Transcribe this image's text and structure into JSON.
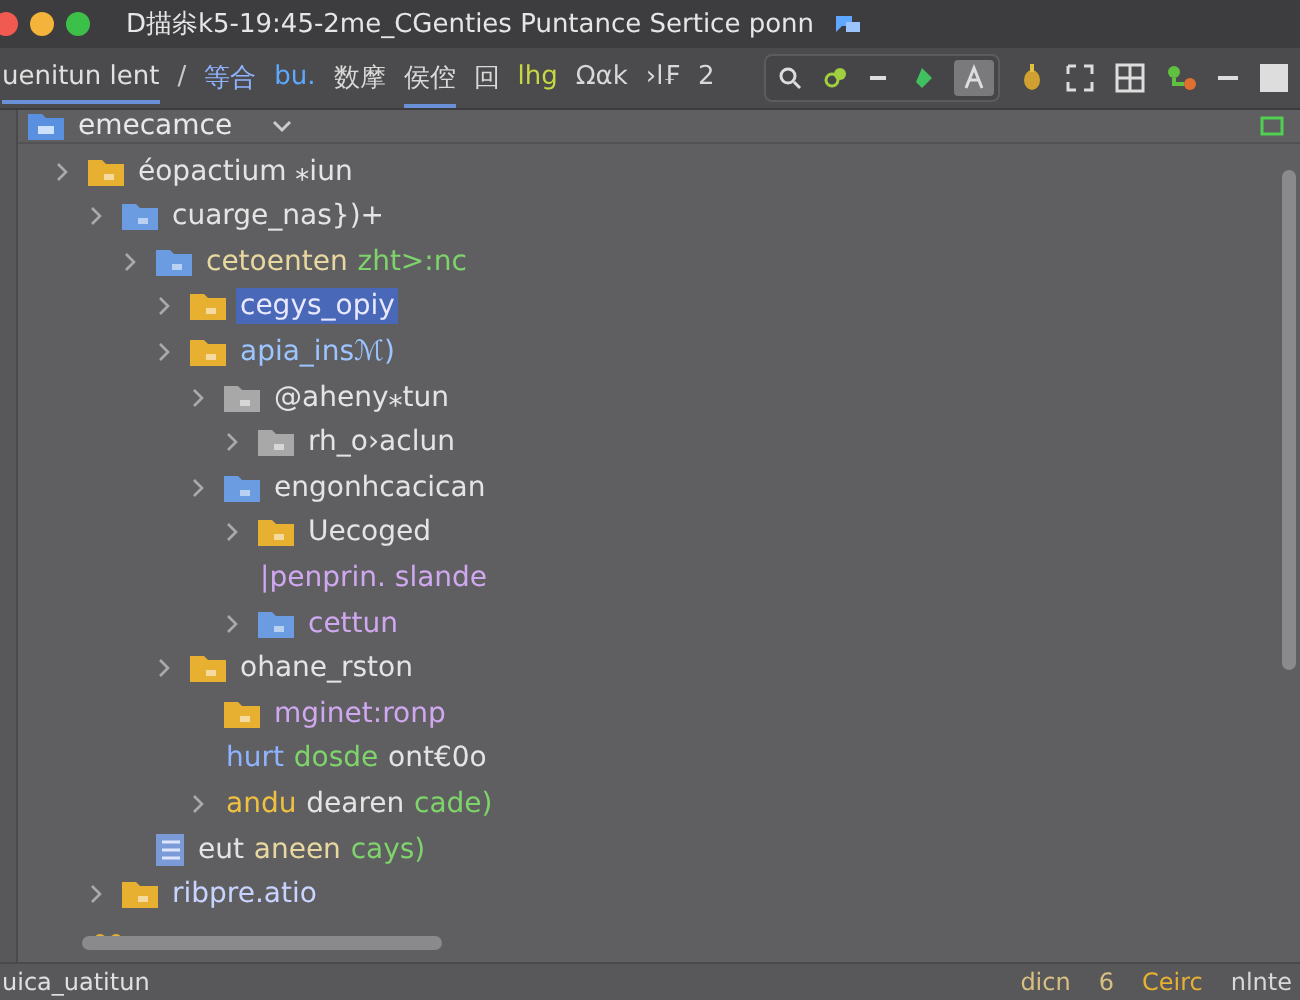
{
  "window": {
    "title": "D描尜k5-19:45-2me_CGenties  Puntance  Sertice  ponn"
  },
  "toolbar": {
    "tabs": [
      {
        "label": "uenitun lent",
        "selected": true,
        "color": "#e0e0e0"
      },
      {
        "label": "/",
        "selected": false,
        "color": "#c8c8c8"
      },
      {
        "label": "等合",
        "selected": false,
        "color": "#8fb4ff"
      },
      {
        "label": "bu.",
        "selected": false,
        "color": "#5fa8ff"
      },
      {
        "label": "数摩",
        "selected": false,
        "color": "#d8d8d8"
      },
      {
        "label": "侯倥",
        "selected": true,
        "color": "#d8d8d8"
      },
      {
        "label": "回",
        "selected": false,
        "color": "#d8d8d8"
      },
      {
        "label": "lhg",
        "selected": false,
        "color": "#c8d840"
      },
      {
        "label": "Ωαk",
        "selected": false,
        "color": "#d8d8d8"
      },
      {
        "label": "›l₣",
        "selected": false,
        "color": "#d8d8d8"
      },
      {
        "label": "2",
        "selected": false,
        "color": "#d8d8d8"
      }
    ]
  },
  "project": {
    "name": "emecamce"
  },
  "tree": [
    {
      "kind": "folder",
      "color": "#e8b030",
      "arrow": true,
      "selected": false,
      "parts": [
        {
          "text": "éopactium ⁎iun",
          "color": "#e4e4e4"
        }
      ],
      "children": [
        {
          "kind": "folder",
          "color": "#6b9be0",
          "arrow": true,
          "selected": false,
          "parts": [
            {
              "text": "cuarge_nas})+",
              "color": "#e4e4e4"
            }
          ],
          "children": [
            {
              "kind": "folder",
              "color": "#6b9be0",
              "arrow": true,
              "selected": false,
              "parts": [
                {
                  "text": "cetoenten",
                  "color": "#e8d8a0"
                },
                {
                  "text": "zht>:nc",
                  "color": "#7ed36a"
                }
              ],
              "children": [
                {
                  "kind": "folder",
                  "color": "#e8b030",
                  "arrow": true,
                  "selected": true,
                  "parts": [
                    {
                      "text": "cegys_opiy",
                      "color": "#e8e8ff"
                    }
                  ]
                },
                {
                  "kind": "folder",
                  "color": "#e8b030",
                  "arrow": true,
                  "selected": false,
                  "parts": [
                    {
                      "text": "apia_insℳ)",
                      "color": "#9cc4ff"
                    }
                  ],
                  "children": [
                    {
                      "kind": "folder",
                      "color": "#a8a8a8",
                      "arrow": true,
                      "selected": false,
                      "parts": [
                        {
                          "text": "@aheny⁎tun",
                          "color": "#e4e4e4"
                        }
                      ],
                      "children": [
                        {
                          "kind": "folder",
                          "color": "#a8a8a8",
                          "arrow": true,
                          "selected": false,
                          "parts": [
                            {
                              "text": "rh_o›aclun",
                              "color": "#e4e4e4"
                            }
                          ]
                        }
                      ]
                    },
                    {
                      "kind": "folder",
                      "color": "#6b9be0",
                      "arrow": true,
                      "selected": false,
                      "parts": [
                        {
                          "text": "engonhcacican",
                          "color": "#e4e4e4"
                        }
                      ],
                      "children": [
                        {
                          "kind": "folder",
                          "color": "#e8b030",
                          "arrow": true,
                          "selected": false,
                          "parts": [
                            {
                              "text": "Uecoged",
                              "color": "#e4e4e4"
                            }
                          ]
                        },
                        {
                          "kind": "text",
                          "arrow": false,
                          "selected": false,
                          "parts": [
                            {
                              "text": "|penprin. slande",
                              "color": "#d0a8f0"
                            }
                          ]
                        },
                        {
                          "kind": "folder",
                          "color": "#6b9be0",
                          "arrow": true,
                          "selected": false,
                          "parts": [
                            {
                              "text": "cettun",
                              "color": "#d0a8f0"
                            }
                          ]
                        }
                      ]
                    }
                  ]
                },
                {
                  "kind": "folder",
                  "color": "#e8b030",
                  "arrow": true,
                  "selected": false,
                  "parts": [
                    {
                      "text": "ohane_rston",
                      "color": "#e4e4e4"
                    }
                  ],
                  "children": [
                    {
                      "kind": "folder",
                      "color": "#e8b030",
                      "arrow": false,
                      "selected": false,
                      "parts": [
                        {
                          "text": "mginet:ronp",
                          "color": "#d0a8f0"
                        }
                      ]
                    },
                    {
                      "kind": "text",
                      "arrow": false,
                      "selected": false,
                      "parts": [
                        {
                          "text": "hurt",
                          "color": "#8fb4ff"
                        },
                        {
                          "text": "dosde",
                          "color": "#7ed36a"
                        },
                        {
                          "text": "ont€0o",
                          "color": "#e4e4e4"
                        }
                      ]
                    },
                    {
                      "kind": "text",
                      "arrow": true,
                      "selected": false,
                      "parts": [
                        {
                          "text": "andu",
                          "color": "#f0c040"
                        },
                        {
                          "text": "dearen",
                          "color": "#e4e4e4"
                        },
                        {
                          "text": "cade)",
                          "color": "#7ed36a"
                        }
                      ]
                    }
                  ]
                }
              ]
            },
            {
              "kind": "list",
              "arrow": false,
              "selected": false,
              "parts": [
                {
                  "text": "eut",
                  "color": "#e4e4e4"
                },
                {
                  "text": "aneen",
                  "color": "#e8d8a0"
                },
                {
                  "text": "cays)",
                  "color": "#7ed36a"
                }
              ]
            }
          ]
        },
        {
          "kind": "folder",
          "color": "#e8b030",
          "arrow": true,
          "selected": false,
          "parts": [
            {
              "text": "ribpre.atio",
              "color": "#c8d4ff"
            }
          ]
        }
      ]
    }
  ],
  "status_bar": {
    "left": "uica_uatitun",
    "right": [
      {
        "text": "dicn",
        "color": "#d8c080"
      },
      {
        "text": "6",
        "color": "#d8c080"
      },
      {
        "text": "Ceirc",
        "color": "#e8b030"
      },
      {
        "text": "nlnte",
        "color": "#d8d8d8"
      }
    ]
  }
}
